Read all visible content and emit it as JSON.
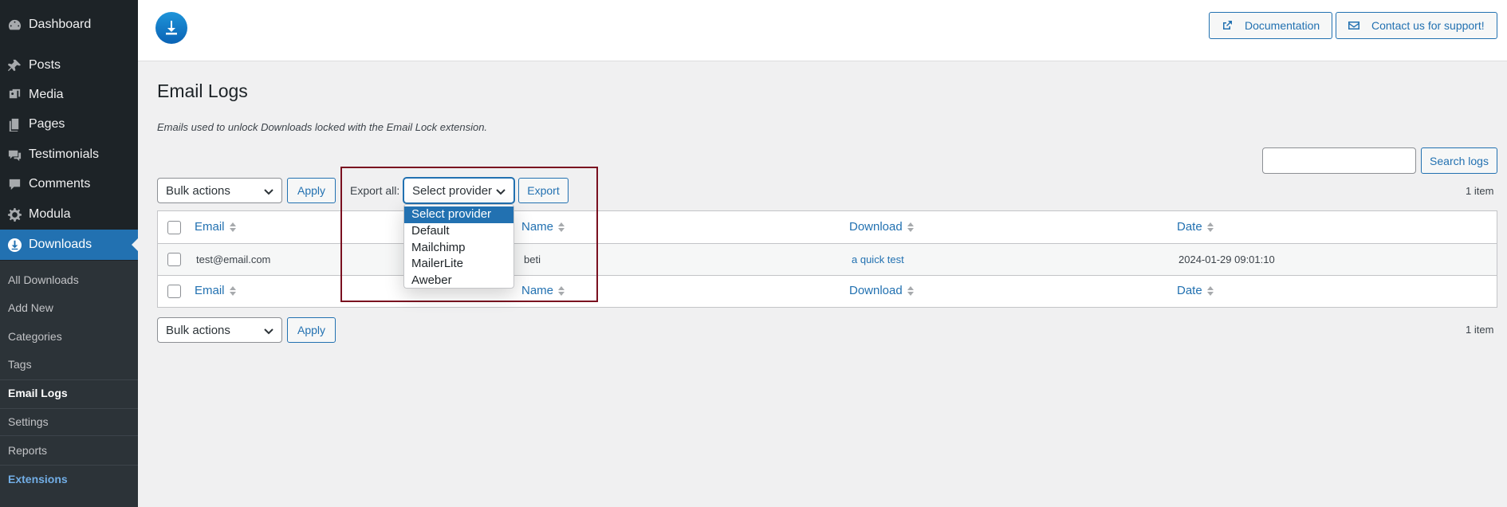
{
  "sidebar": {
    "menu": [
      {
        "label": "Dashboard",
        "icon": "dashboard-icon"
      },
      {
        "label": "Posts",
        "icon": "pin-icon"
      },
      {
        "label": "Media",
        "icon": "media-icon"
      },
      {
        "label": "Pages",
        "icon": "pages-icon"
      },
      {
        "label": "Testimonials",
        "icon": "testimonials-icon"
      },
      {
        "label": "Comments",
        "icon": "comment-icon"
      },
      {
        "label": "Modula",
        "icon": "gear-icon"
      },
      {
        "label": "Downloads",
        "icon": "download-icon"
      }
    ],
    "submenu": [
      "All Downloads",
      "Add New",
      "Categories",
      "Tags",
      "Email Logs",
      "Settings",
      "Reports",
      "Extensions"
    ]
  },
  "header": {
    "documentation_label": "Documentation",
    "support_label": "Contact us for support!"
  },
  "main": {
    "title": "Email Logs",
    "description": "Emails used to unlock Downloads locked with the Email Lock extension.",
    "search_button": "Search logs",
    "search_value": "",
    "bulk_actions": "Bulk actions",
    "apply_label": "Apply",
    "export_all_label": "Export all:",
    "provider_selected": "Select provider",
    "export_button": "Export",
    "item_count": "1 item",
    "provider_options": [
      "Select provider",
      "Default",
      "Mailchimp",
      "MailerLite",
      "Aweber"
    ]
  },
  "table": {
    "columns": [
      "Email",
      "Name",
      "Download",
      "Date"
    ],
    "rows": [
      {
        "email": "test@email.com",
        "name": "beti",
        "download": "a quick test",
        "date": "2024-01-29 09:01:10"
      }
    ]
  },
  "colors": {
    "sidebar_bg": "#1d2327",
    "accent": "#2271b1",
    "highlight_box": "#7a1020"
  }
}
